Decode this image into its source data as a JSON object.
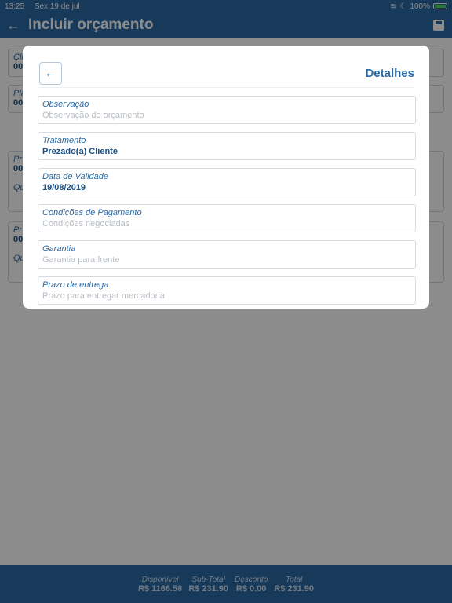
{
  "status_bar": {
    "time": "13:25",
    "date": "Sex 19 de jul",
    "battery": "100%"
  },
  "header": {
    "title": "Incluir orçamento"
  },
  "background": {
    "box1_label": "Cli",
    "box1_value": "00",
    "box2_label": "Pla",
    "box2_value": "00",
    "box3_label": "Pr",
    "box3_value": "00",
    "box3_sub": "Qu",
    "box4_label": "Pr",
    "box4_value": "00",
    "box4_sub": "Qu"
  },
  "modal": {
    "title": "Detalhes",
    "fields": [
      {
        "label": "Observação",
        "placeholder": "Observação do orçamento",
        "value": ""
      },
      {
        "label": "Tratamento",
        "placeholder": "",
        "value": "Prezado(a) Cliente"
      },
      {
        "label": "Data de Validade",
        "placeholder": "",
        "value": "19/08/2019"
      },
      {
        "label": "Condições de Pagamento",
        "placeholder": "Condições negociadas",
        "value": ""
      },
      {
        "label": "Garantia",
        "placeholder": "Garantia para frente",
        "value": ""
      },
      {
        "label": "Prazo de entrega",
        "placeholder": "Prazo para entregar mercadoria",
        "value": ""
      }
    ]
  },
  "footer": {
    "disponivel_label": "Disponível",
    "disponivel_value": "R$ 1166.58",
    "subtotal_label": "Sub-Total",
    "subtotal_value": "R$ 231.90",
    "desconto_label": "Desconto",
    "desconto_value": "R$ 0.00",
    "total_label": "Total",
    "total_value": "R$ 231.90"
  }
}
